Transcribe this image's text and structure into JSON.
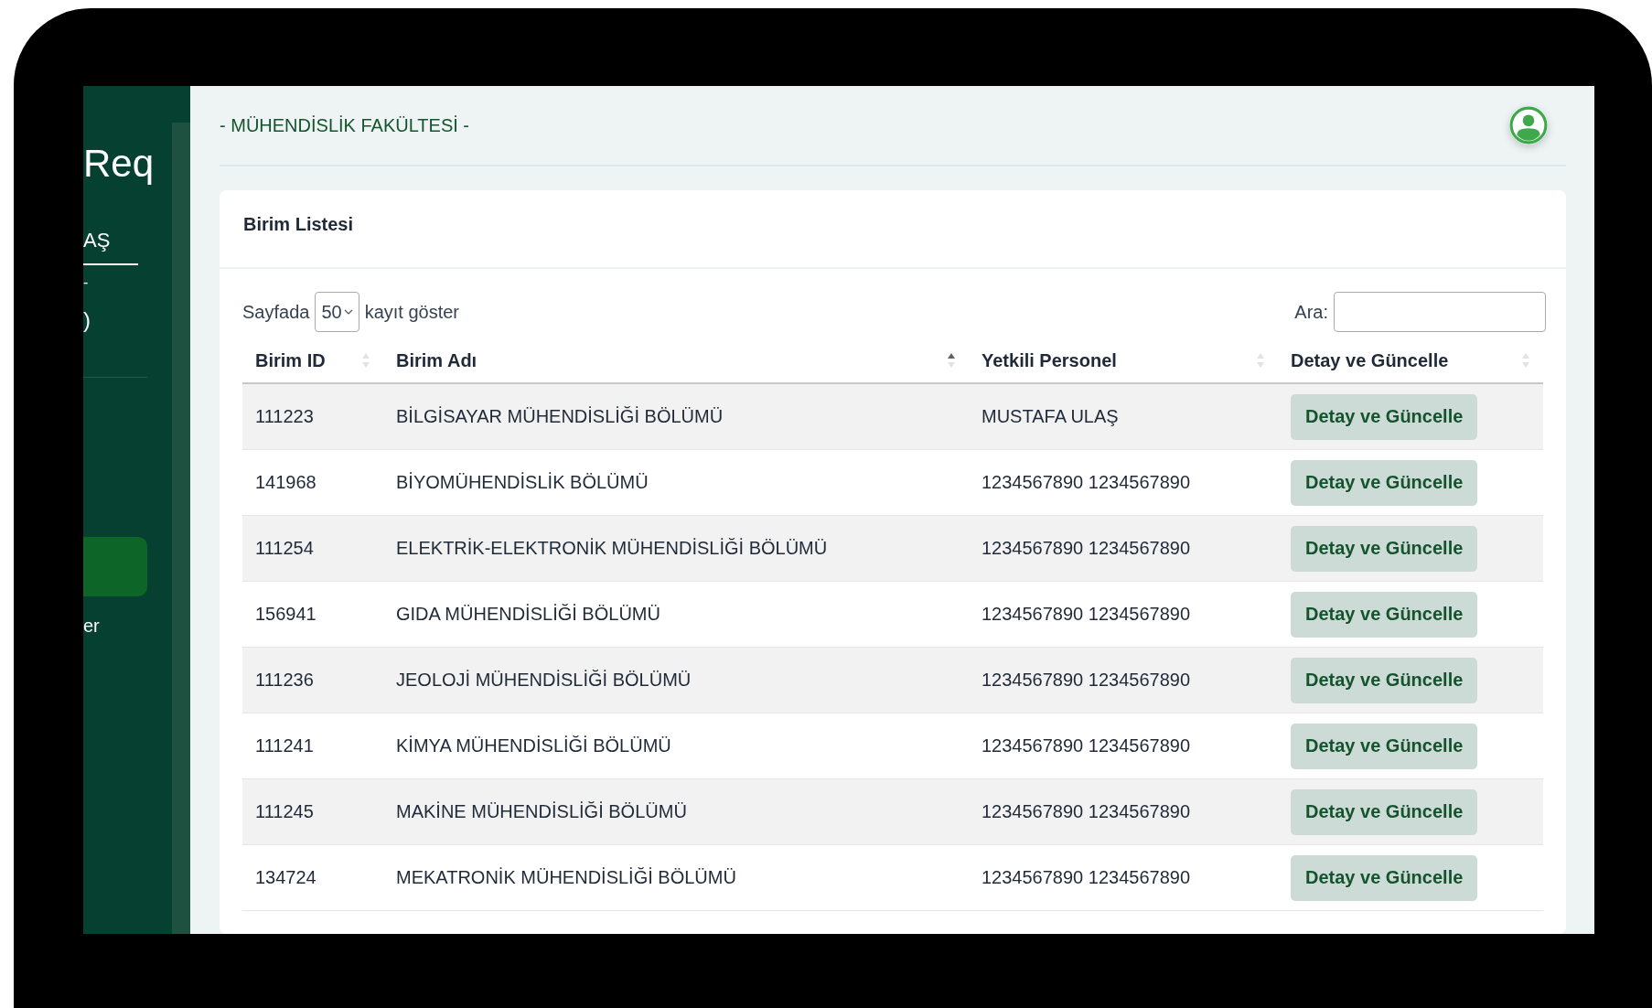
{
  "sidebar": {
    "brand": "Req",
    "user_name": "AŞ",
    "user_line_2": "-",
    "user_line_3": ")",
    "menu": [
      {
        "selected": true
      },
      {
        "label": "er",
        "selected": false
      }
    ]
  },
  "header": {
    "title": "- MÜHENDİSLİK FAKÜLTESİ -"
  },
  "card": {
    "title": "Birim Listesi",
    "length_prefix": "Sayfada",
    "length_value": "50",
    "length_suffix": "kayıt göster",
    "search_label": "Ara:",
    "table": {
      "columns": [
        {
          "label": "Birim ID",
          "sorted_ascending": false
        },
        {
          "label": "Birim Adı",
          "sorted_ascending": true
        },
        {
          "label": "Yetkili Personel",
          "sorted_ascending": false
        },
        {
          "label": "Detay ve Güncelle",
          "sorted_ascending": false
        }
      ],
      "rows": [
        {
          "id": "111223",
          "name": "BİLGİSAYAR MÜHENDİSLİĞİ BÖLÜMÜ",
          "person": "MUSTAFA ULAŞ",
          "action": "Detay ve Güncelle"
        },
        {
          "id": "141968",
          "name": "BİYOMÜHENDİSLİK BÖLÜMÜ",
          "person": "1234567890 1234567890",
          "action": "Detay ve Güncelle"
        },
        {
          "id": "111254",
          "name": "ELEKTRİK-ELEKTRONİK MÜHENDİSLİĞİ BÖLÜMÜ",
          "person": "1234567890 1234567890",
          "action": "Detay ve Güncelle"
        },
        {
          "id": "156941",
          "name": "GIDA MÜHENDİSLİĞİ BÖLÜMÜ",
          "person": "1234567890 1234567890",
          "action": "Detay ve Güncelle"
        },
        {
          "id": "111236",
          "name": "JEOLOJİ MÜHENDİSLİĞİ BÖLÜMÜ",
          "person": "1234567890 1234567890",
          "action": "Detay ve Güncelle"
        },
        {
          "id": "111241",
          "name": "KİMYA MÜHENDİSLİĞİ BÖLÜMÜ",
          "person": "1234567890 1234567890",
          "action": "Detay ve Güncelle"
        },
        {
          "id": "111245",
          "name": "MAKİNE MÜHENDİSLİĞİ BÖLÜMÜ",
          "person": "1234567890 1234567890",
          "action": "Detay ve Güncelle"
        },
        {
          "id": "134724",
          "name": "MEKATRONİK MÜHENDİSLİĞİ BÖLÜMÜ",
          "person": "1234567890 1234567890",
          "action": "Detay ve Güncelle"
        }
      ]
    }
  }
}
